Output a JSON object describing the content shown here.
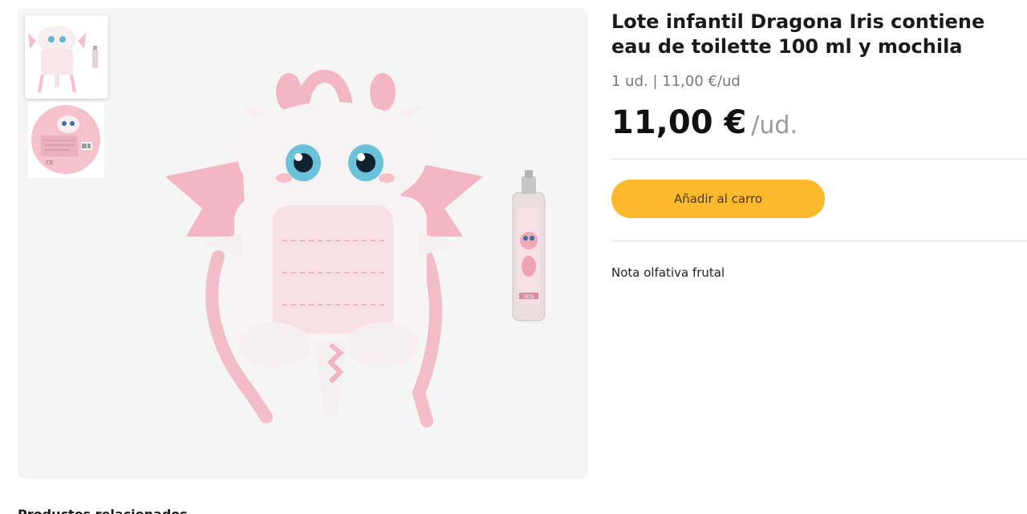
{
  "product": {
    "title": "Lote infantil Dragona Iris contiene eau de toilette 100 ml y mochila",
    "unit_info": "1 ud. | 11,00 €/ud",
    "price": "11,00 €",
    "price_unit": "/ud.",
    "add_to_cart_label": "Añadir al carro",
    "note": "Nota olfativa frutal",
    "bottle_label": "IRIS"
  },
  "section": {
    "related_title": "Productos relacionados"
  },
  "colors": {
    "accent_button": "#fdb92c",
    "gallery_bg": "#f5f5f5",
    "backpack_pink": "#f4b6c2"
  }
}
